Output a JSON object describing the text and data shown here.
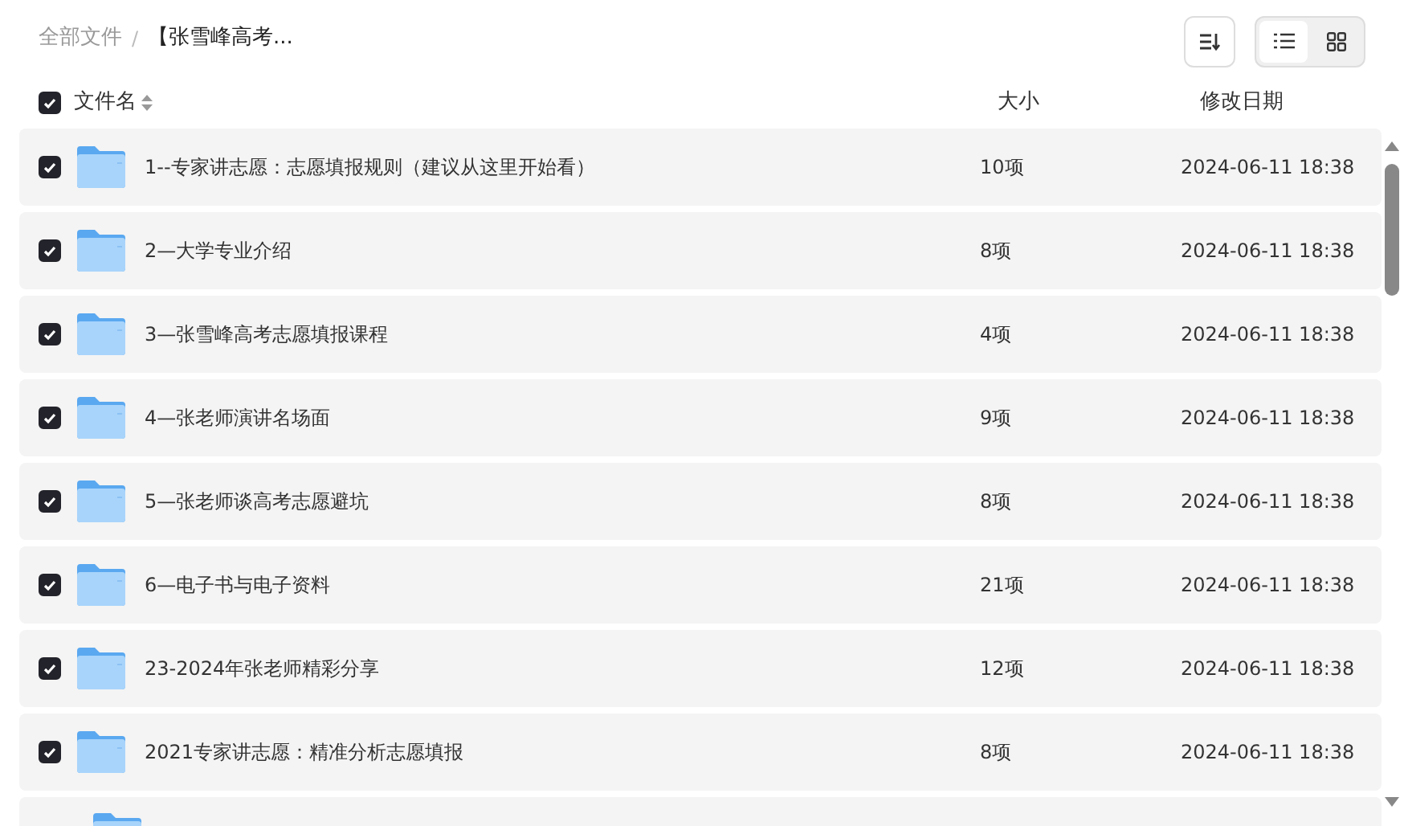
{
  "breadcrumb": [
    {
      "label": "全部文件",
      "current": false
    },
    {
      "label": "【张雪峰高考...",
      "current": true
    }
  ],
  "breadcrumb_separator": "/",
  "view_modes": [
    {
      "kind": "list",
      "selected": true
    },
    {
      "kind": "grid",
      "selected": false
    }
  ],
  "header": {
    "checked": true,
    "columns": [
      "文件名",
      "大小",
      "修改日期"
    ]
  },
  "rows": [
    {
      "name": "1--专家讲志愿：志愿填报规则（建议从这里开始看）",
      "size": "10项",
      "modified": "2024-06-11 18:38",
      "checked": true
    },
    {
      "name": "2—大学专业介绍",
      "size": "8项",
      "modified": "2024-06-11 18:38",
      "checked": true
    },
    {
      "name": "3—张雪峰高考志愿填报课程",
      "size": "4项",
      "modified": "2024-06-11 18:38",
      "checked": true
    },
    {
      "name": "4—张老师演讲名场面",
      "size": "9项",
      "modified": "2024-06-11 18:38",
      "checked": true
    },
    {
      "name": "5—张老师谈高考志愿避坑",
      "size": "8项",
      "modified": "2024-06-11 18:38",
      "checked": true
    },
    {
      "name": "6—电子书与电子资料",
      "size": "21项",
      "modified": "2024-06-11 18:38",
      "checked": true
    },
    {
      "name": "23-2024年张老师精彩分享",
      "size": "12项",
      "modified": "2024-06-11 18:38",
      "checked": true
    },
    {
      "name": "2021专家讲志愿：精准分析志愿填报",
      "size": "8项",
      "modified": "2024-06-11 18:38",
      "checked": true
    }
  ]
}
